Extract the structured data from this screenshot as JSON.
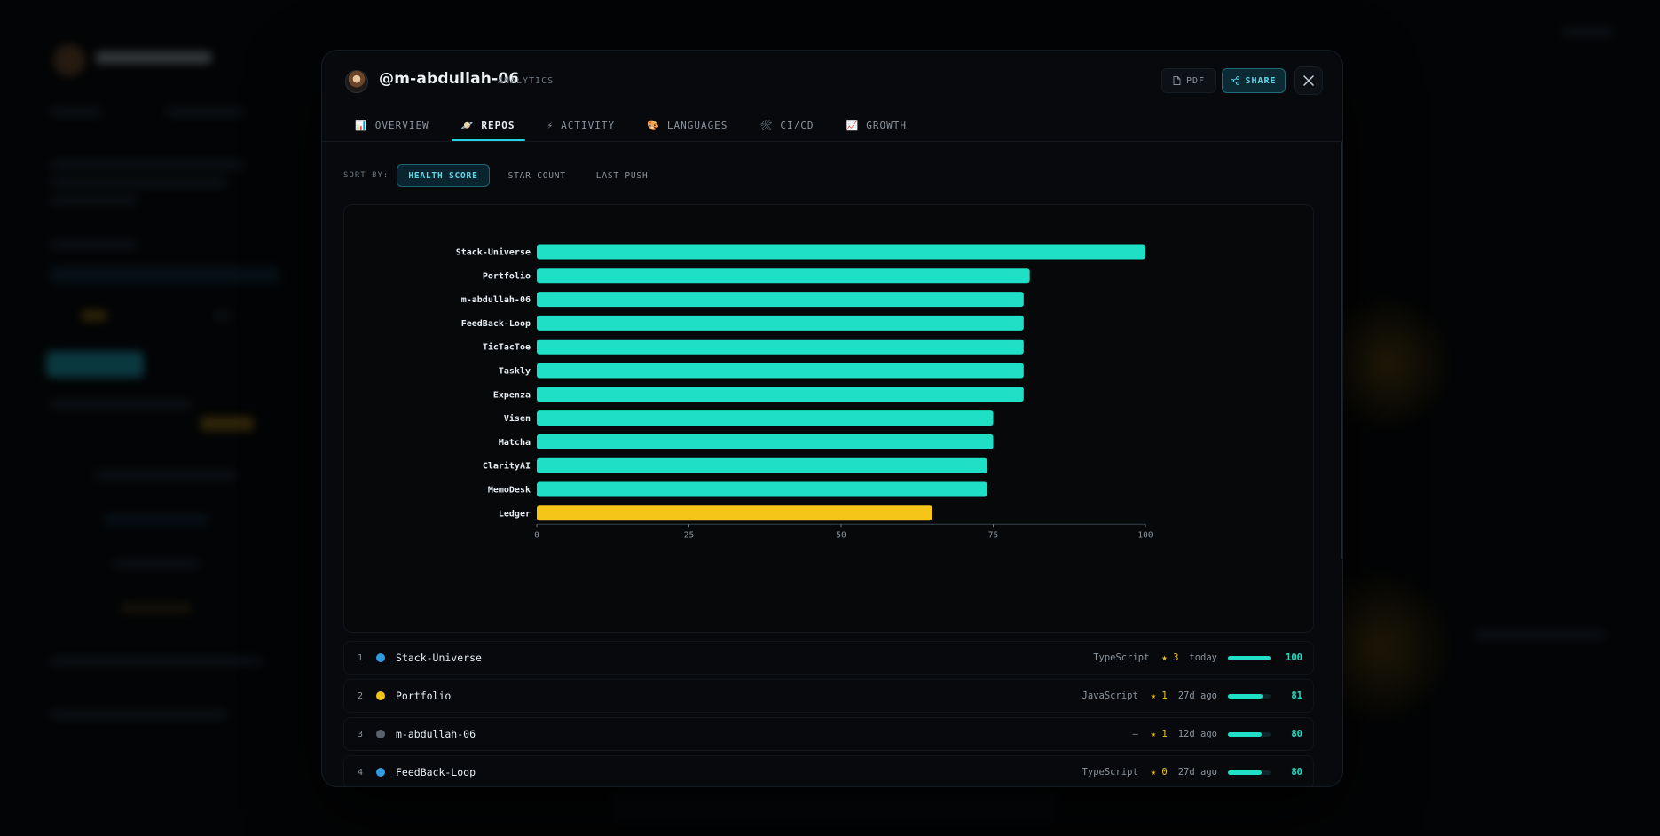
{
  "modal": {
    "handle": "@m-abdullah-06",
    "subtitle": "ANALYTICS",
    "pdf_label": "PDF",
    "share_label": "SHARE"
  },
  "tabs": [
    {
      "label": "OVERVIEW",
      "icon": "📊"
    },
    {
      "label": "REPOS",
      "icon": "🪐"
    },
    {
      "label": "ACTIVITY",
      "icon": "⚡"
    },
    {
      "label": "LANGUAGES",
      "icon": "🎨"
    },
    {
      "label": "CI/CD",
      "icon": "🛠"
    },
    {
      "label": "GROWTH",
      "icon": "📈"
    }
  ],
  "sort": {
    "label": "SORT BY:",
    "options": [
      "HEALTH SCORE",
      "STAR COUNT",
      "LAST PUSH"
    ],
    "selected": "HEALTH SCORE"
  },
  "colors": {
    "accent_cyan": "#25d5e4",
    "bar_teal": "#1fe0c6",
    "bar_gold": "#f5c518",
    "typescript": "#2f9be0",
    "javascript": "#f0c21a",
    "none": "#6e7781"
  },
  "chart_data": {
    "type": "bar",
    "orientation": "horizontal",
    "categories": [
      "Stack-Universe",
      "Portfolio",
      "m-abdullah-06",
      "FeedBack-Loop",
      "TicTacToe",
      "Taskly",
      "Expenza",
      "Visen",
      "Matcha",
      "ClarityAI",
      "MemoDesk",
      "Ledger"
    ],
    "values": [
      100,
      81,
      80,
      80,
      80,
      80,
      80,
      75,
      75,
      74,
      74,
      65
    ],
    "bar_colors": [
      "#1fe0c6",
      "#1fe0c6",
      "#1fe0c6",
      "#1fe0c6",
      "#1fe0c6",
      "#1fe0c6",
      "#1fe0c6",
      "#1fe0c6",
      "#1fe0c6",
      "#1fe0c6",
      "#1fe0c6",
      "#f5c518"
    ],
    "xlim": [
      0,
      100
    ],
    "xticks": [
      0,
      25,
      50,
      75,
      100
    ],
    "grid": false,
    "legend": "none"
  },
  "repos": [
    {
      "rank": "1",
      "name": "Stack-Universe",
      "language": "TypeScript",
      "lang_color": "#2f9be0",
      "stars": "★ 3",
      "pushed": "today",
      "score": "100",
      "score_value": 100
    },
    {
      "rank": "2",
      "name": "Portfolio",
      "language": "JavaScript",
      "lang_color": "#f0c21a",
      "stars": "★ 1",
      "pushed": "27d ago",
      "score": "81",
      "score_value": 81
    },
    {
      "rank": "3",
      "name": "m-abdullah-06",
      "language": "—",
      "lang_color": "#5a6270",
      "stars": "★ 1",
      "pushed": "12d ago",
      "score": "80",
      "score_value": 80
    },
    {
      "rank": "4",
      "name": "FeedBack-Loop",
      "language": "TypeScript",
      "lang_color": "#2f9be0",
      "stars": "★ 0",
      "pushed": "27d ago",
      "score": "80",
      "score_value": 80
    }
  ]
}
